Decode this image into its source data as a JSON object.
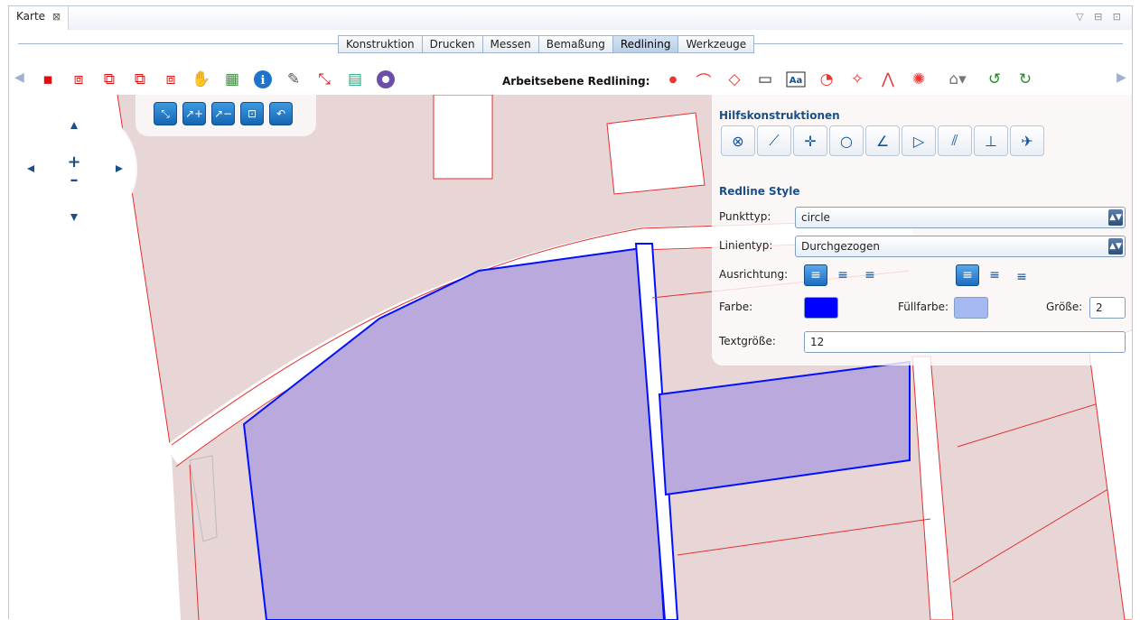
{
  "window": {
    "tab_title": "Karte",
    "tab_close": "⊠",
    "controls": "▽ ⊟ ⊡"
  },
  "menu": {
    "items": [
      "Konstruktion",
      "Drucken",
      "Messen",
      "Bemaßung",
      "Redlining",
      "Werkzeuge"
    ],
    "active": "Redlining"
  },
  "toolbar": {
    "label": "Arbeitsebene Redlining:",
    "left_icons": [
      "select-layer-icon",
      "select-multi-icon",
      "select-add-icon",
      "select-remove-icon",
      "select-clear-icon",
      "pan-hand-icon",
      "table-icon",
      "info-icon",
      "edit-icon",
      "move-icon",
      "layer-tool-icon",
      "circle-tool-icon"
    ],
    "redline_icons": [
      "point-icon",
      "polyline-icon",
      "polygon-icon",
      "rectangle-icon",
      "text-icon",
      "circle-icon",
      "freehand-icon",
      "angle-icon",
      "bubble-icon",
      "snap-dropdown-icon",
      "undo-icon",
      "redo-icon"
    ]
  },
  "zoom_tools": [
    "zoom-box-icon",
    "zoom-in-icon",
    "zoom-out-icon",
    "zoom-extent-icon",
    "zoom-back-icon"
  ],
  "nav": {
    "zoom_in": "+",
    "zoom_out": "–"
  },
  "hilfskonstruktionen": {
    "title": "Hilfskonstruktionen",
    "tools": [
      {
        "name": "snap-icon",
        "glyph": "⊗"
      },
      {
        "name": "line-icon",
        "glyph": "⟋"
      },
      {
        "name": "point-cross-icon",
        "glyph": "✛"
      },
      {
        "name": "circle-outline-icon",
        "glyph": "○"
      },
      {
        "name": "angle-line-icon",
        "glyph": "∠"
      },
      {
        "name": "triangle-icon",
        "glyph": "▷"
      },
      {
        "name": "parallel-icon",
        "glyph": "⫽"
      },
      {
        "name": "perpendicular-icon",
        "glyph": "⊥"
      },
      {
        "name": "satellite-icon",
        "glyph": "✈"
      }
    ]
  },
  "redline_style": {
    "title": "Redline Style",
    "punkttyp_label": "Punkttyp:",
    "punkttyp_value": "circle",
    "linientyp_label": "Linientyp:",
    "linientyp_value": "Durchgezogen",
    "ausrichtung_label": "Ausrichtung:",
    "farbe_label": "Farbe:",
    "farbe_color": "#0000ff",
    "fuellfarbe_label": "Füllfarbe:",
    "fuellfarbe_color": "#a6b8f0",
    "groesse_label": "Größe:",
    "groesse_value": "2",
    "textgroesse_label": "Textgröße:",
    "textgroesse_value": "12"
  },
  "colors": {
    "map_bg": "#e8d6d7",
    "parcel_fill": "#b9a9dc",
    "parcel_stroke": "#0010ff",
    "road_stroke": "#e23030"
  }
}
